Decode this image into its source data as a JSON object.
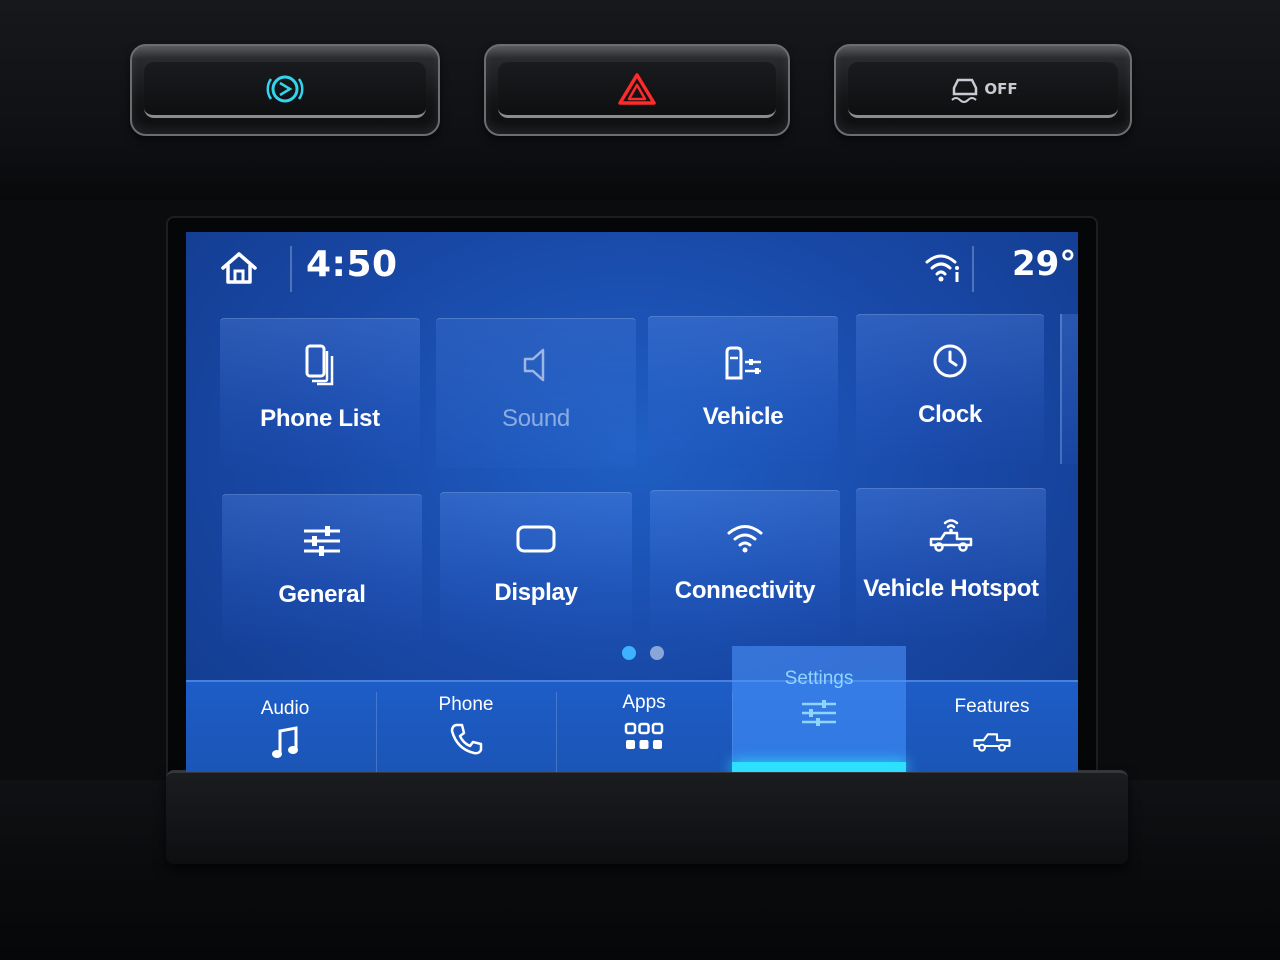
{
  "status_bar": {
    "time": "4:50",
    "temperature": "29°",
    "home_icon": "home-icon",
    "wifi_icon": "wifi-info-icon"
  },
  "settings_tiles": [
    {
      "id": "phone-list",
      "label": "Phone List",
      "icon": "phone-list-icon",
      "enabled": true
    },
    {
      "id": "sound",
      "label": "Sound",
      "icon": "speaker-icon",
      "enabled": false
    },
    {
      "id": "vehicle",
      "label": "Vehicle",
      "icon": "vehicle-settings-icon",
      "enabled": true
    },
    {
      "id": "clock",
      "label": "Clock",
      "icon": "clock-icon",
      "enabled": true
    },
    {
      "id": "general",
      "label": "General",
      "icon": "sliders-icon",
      "enabled": true
    },
    {
      "id": "display",
      "label": "Display",
      "icon": "display-icon",
      "enabled": true
    },
    {
      "id": "connectivity",
      "label": "Connectivity",
      "icon": "wifi-icon",
      "enabled": true
    },
    {
      "id": "vehicle-hotspot",
      "label": "Vehicle Hotspot",
      "icon": "truck-hotspot-icon",
      "enabled": true
    }
  ],
  "pagination": {
    "pages": 2,
    "current": 1
  },
  "nav": [
    {
      "id": "audio",
      "label": "Audio",
      "icon": "music-note-icon",
      "active": false
    },
    {
      "id": "phone",
      "label": "Phone",
      "icon": "phone-handset-icon",
      "active": false
    },
    {
      "id": "apps",
      "label": "Apps",
      "icon": "apps-grid-icon",
      "active": false
    },
    {
      "id": "settings",
      "label": "Settings",
      "icon": "sliders-icon",
      "active": true
    },
    {
      "id": "features",
      "label": "Features",
      "icon": "truck-icon",
      "active": false
    }
  ],
  "hardware_buttons": [
    {
      "id": "brake-hold",
      "icon": "auto-hold-icon",
      "color": "#32d4ee"
    },
    {
      "id": "hazard",
      "icon": "hazard-triangle-icon",
      "color": "#ff2a2a"
    },
    {
      "id": "traction-control",
      "icon": "traction-off-icon",
      "label": "OFF",
      "color": "#c8ccd2"
    }
  ],
  "colors": {
    "screen_blue": "#1847a5",
    "active_accent": "#2ee0ff",
    "page_dot_active": "#3fb2ff"
  }
}
